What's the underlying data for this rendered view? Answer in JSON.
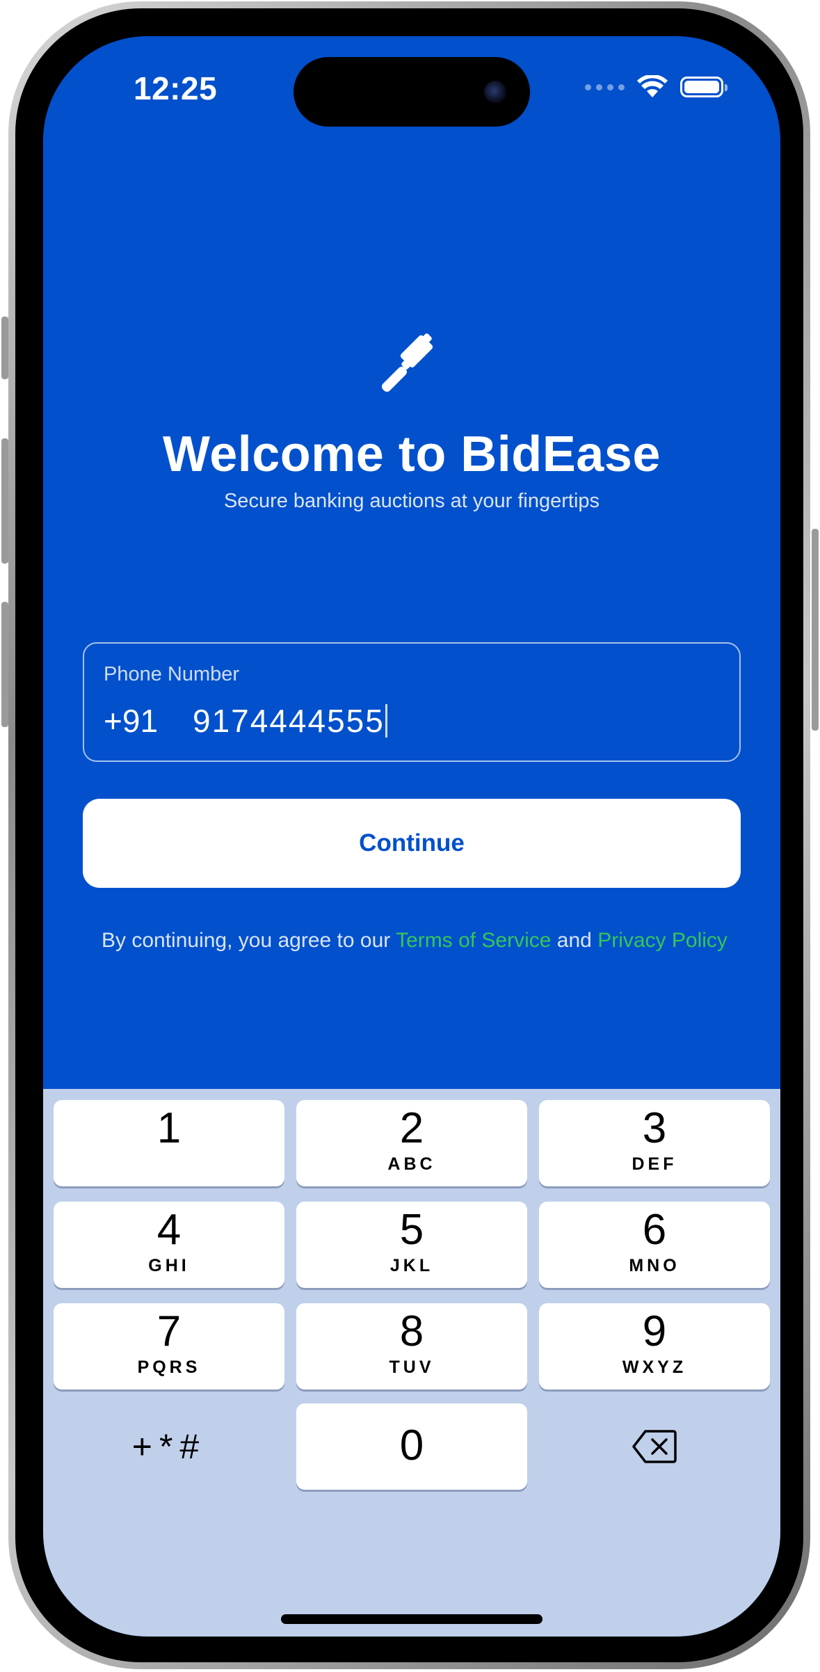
{
  "status_bar": {
    "time": "12:25"
  },
  "welcome": {
    "title": "Welcome to BidEase",
    "subtitle": "Secure banking auctions at your fingertips",
    "icon": "gavel-icon"
  },
  "phone_input": {
    "label": "Phone Number",
    "country_code": "+91",
    "value": "9174444555"
  },
  "continue_button": {
    "label": "Continue"
  },
  "legal": {
    "prefix": "By continuing, you agree to our ",
    "terms_link": "Terms of Service",
    "and": " and ",
    "privacy_link": "Privacy Policy"
  },
  "keypad": {
    "keys": [
      {
        "num": "1",
        "letters": ""
      },
      {
        "num": "2",
        "letters": "ABC"
      },
      {
        "num": "3",
        "letters": "DEF"
      },
      {
        "num": "4",
        "letters": "GHI"
      },
      {
        "num": "5",
        "letters": "JKL"
      },
      {
        "num": "6",
        "letters": "MNO"
      },
      {
        "num": "7",
        "letters": "PQRS"
      },
      {
        "num": "8",
        "letters": "TUV"
      },
      {
        "num": "9",
        "letters": "WXYZ"
      },
      {
        "num": "0",
        "letters": ""
      }
    ],
    "symbols": "+*#",
    "delete_icon": "backspace-icon"
  },
  "colors": {
    "background": "#0250cc",
    "keyboard": "#c0d0eb",
    "link": "#34c759",
    "button_text": "#0250cc"
  }
}
